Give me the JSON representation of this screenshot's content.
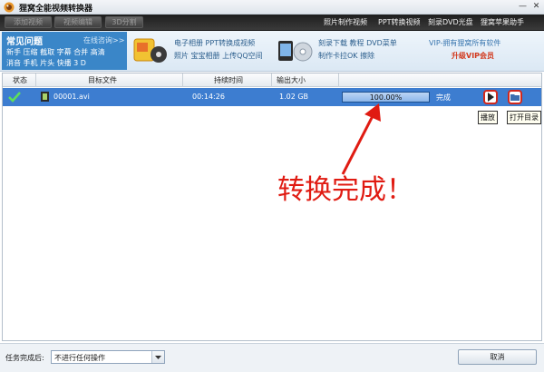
{
  "window": {
    "title": "狸窝全能视频转换器",
    "minimize_glyph": "—",
    "close_glyph": "✕"
  },
  "toolbar": {
    "add_video": "添加视频",
    "video_edit": "视频编辑",
    "split": "3D分割",
    "links": [
      "照片制作视频",
      "PPT转换视频",
      "刻录DVD光盘",
      "狸窝苹果助手"
    ]
  },
  "banner": {
    "faq_title": "常见问题",
    "faq_online": "在线咨询>>",
    "faq_row1": "新手 压缩 截取 字幕 合并 高清",
    "faq_row2": "消音 手机 片头 快播 3 D",
    "promo1_line1": "电子相册 PPT转换成视频",
    "promo1_line2": "照片 宝宝相册 上传QQ空间",
    "promo2_line1": "刻录下载 教程 DVD菜单",
    "promo2_line2": "制作卡拉OK 擦除",
    "vip_line1": "VIP-拥有狸窝所有软件",
    "vip_line2": "升级VIP会员"
  },
  "table": {
    "headers": {
      "status": "状态",
      "target": "目标文件",
      "duration": "持续时间",
      "output_size": "输出大小"
    },
    "rows": [
      {
        "file": "00001.avi",
        "duration": "00:14:26",
        "size": "1.02 GB",
        "progress": 100,
        "progress_text": "100.00%",
        "status": "完成"
      }
    ],
    "tooltips": {
      "play": "播放",
      "open_folder": "打开目录"
    }
  },
  "annotation": {
    "text": "转换完成！"
  },
  "footer": {
    "after_label": "任务完成后:",
    "after_value": "不进行任何操作",
    "cancel": "取消"
  },
  "colors": {
    "selected_row": "#3d7dd0",
    "annotation_red": "#e01b12",
    "faq_panel": "#3a86c8",
    "toolbar_dark": "#2c2c2c"
  },
  "icons": {
    "app": "app-logo-icon",
    "status_done": "check-icon",
    "file": "film-file-icon",
    "play": "play-icon",
    "folder": "folder-icon"
  }
}
